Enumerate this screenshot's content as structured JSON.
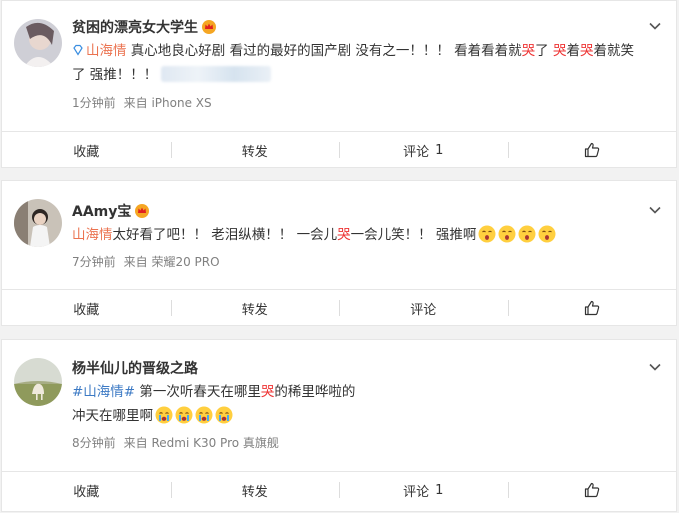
{
  "posts": [
    {
      "user": "贫困的漂亮女大学生",
      "topic": "山海情",
      "text_a": " 真心地良心好剧 看过的最好的国产剧 没有之一！！！ 看着看着就",
      "cry": "哭",
      "text_b": "了 ",
      "cry2": "哭",
      "text_c": "着",
      "cry3": "哭",
      "text_d": "着就笑",
      "line2": "了 强推！！！",
      "time": "1分钟前",
      "source": "来自 iPhone XS",
      "actions": {
        "fav": "收藏",
        "repost": "转发",
        "comment": "评论",
        "comment_count": "1"
      }
    },
    {
      "user": "AAmy宝",
      "topic": "山海情",
      "text_a": "太好看了吧！！ 老泪纵横！！ 一会儿",
      "cry": "哭",
      "text_b": "一会儿笑！！ 强推啊",
      "time": "7分钟前",
      "source": "来自 荣耀20 PRO",
      "actions": {
        "fav": "收藏",
        "repost": "转发",
        "comment": "评论",
        "comment_count": ""
      }
    },
    {
      "user": "杨半仙儿的晋级之路",
      "topic": "#山海情#",
      "text_a": " 第一次听春天在哪里",
      "cry": "哭",
      "text_b": "的稀里哗啦的",
      "line2": "冲天在哪里啊",
      "time": "8分钟前",
      "source": "来自 Redmi K30 Pro 真旗舰",
      "actions": {
        "fav": "收藏",
        "repost": "转发",
        "comment": "评论",
        "comment_count": "1"
      }
    }
  ],
  "colors": {
    "topic": "#eb7350",
    "cry": "#e33333",
    "meta": "#808080"
  },
  "icons": [
    "chevron-down-icon",
    "crown-icon",
    "diamond-icon",
    "thumbs-up-icon",
    "emoji-icon"
  ]
}
